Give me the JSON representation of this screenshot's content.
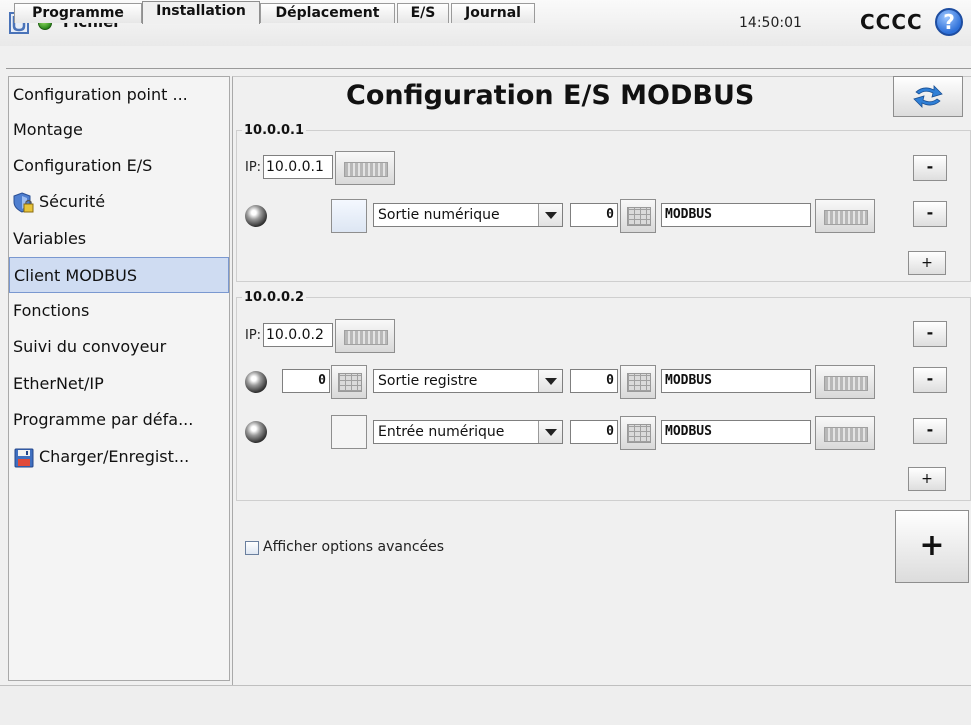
{
  "topbar": {
    "file_menu": "Fichier",
    "clock": "14:50:01",
    "robot_name": "CCCC",
    "help": "?"
  },
  "tabs": [
    "Programme",
    "Installation",
    "Déplacement",
    "E/S",
    "Journal"
  ],
  "sidebar": {
    "items": [
      {
        "label": "Configuration point ..."
      },
      {
        "label": "Montage"
      },
      {
        "label": "Configuration E/S"
      },
      {
        "label": "Sécurité"
      },
      {
        "label": "Variables"
      },
      {
        "label": "Client MODBUS"
      },
      {
        "label": "Fonctions"
      },
      {
        "label": "Suivi du convoyeur"
      },
      {
        "label": "EtherNet/IP"
      },
      {
        "label": "Programme par défa..."
      },
      {
        "label": "Charger/Enregist..."
      }
    ],
    "selected": "Client MODBUS"
  },
  "main": {
    "title": "Configuration E/S MODBUS",
    "groups": [
      {
        "label": "10.0.0.1",
        "ip_prefix": "IP:",
        "ip": "10.0.0.1",
        "signals": [
          {
            "type": "Sortie numérique",
            "address": "0",
            "name": "MODBUS"
          }
        ]
      },
      {
        "label": "10.0.0.2",
        "ip_prefix": "IP:",
        "ip": "10.0.0.2",
        "signals": [
          {
            "value": "0",
            "type": "Sortie registre",
            "address": "0",
            "name": "MODBUS"
          },
          {
            "type": "Entrée numérique",
            "address": "0",
            "name": "MODBUS"
          }
        ]
      }
    ],
    "minus_label": "-",
    "plus_label": "+",
    "add_label": "+",
    "advanced_label": "Afficher options avancées"
  },
  "colors": {
    "selected_bg": "#cfdcf2",
    "status_green": "#2e8b1e"
  }
}
